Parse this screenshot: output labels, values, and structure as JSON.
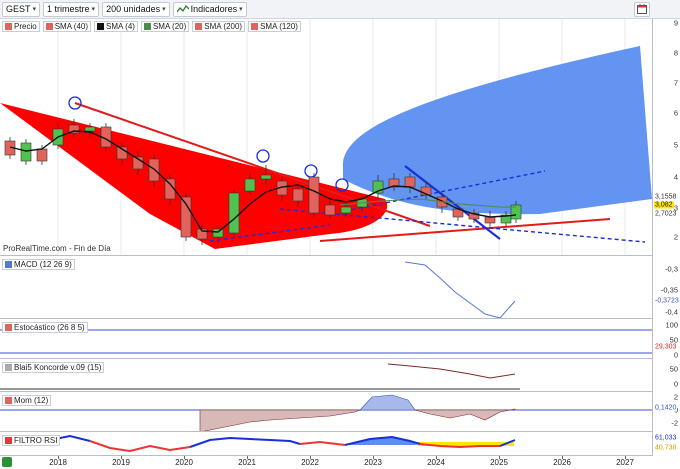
{
  "toolbar": {
    "symbol": "GEST",
    "period": "1 trimestre",
    "units": "200 unidades",
    "indicators_label": "Indicadores"
  },
  "legend": {
    "price": "Precio",
    "sma40": "SMA (40)",
    "sma4": "SMA (4)",
    "sma20": "SMA (20)",
    "sma200": "SMA (200)",
    "sma120": "SMA (120)"
  },
  "watermark": "ProRealTime.com - Fin de Día",
  "price_axis": {
    "ticks": [
      "9",
      "8",
      "7",
      "6",
      "5",
      "4",
      "3",
      "2"
    ],
    "labels": [
      "3,1558",
      "3,082",
      "2,7023"
    ]
  },
  "macd": {
    "label": "MACD (12 26 9)",
    "ticks": [
      "-0,3",
      "-0,35",
      "-0,4"
    ],
    "value": "-0,3723"
  },
  "stoch": {
    "label": "Estocástico (26 8 5)",
    "ticks": [
      "100",
      "50",
      "0"
    ],
    "value": "29,303"
  },
  "blai": {
    "label": "Blai5 Koncorde v.09 (15)",
    "ticks": [
      "50",
      "0"
    ]
  },
  "mom": {
    "label": "Mom (12)",
    "ticks": [
      "2",
      "0",
      "-2"
    ],
    "value": "0,1420"
  },
  "rsi": {
    "label": "FILTRO RSI",
    "ticks": [
      "61,033",
      "40,738"
    ]
  },
  "xaxis": {
    "years": [
      "2018",
      "2019",
      "2020",
      "2021",
      "2022",
      "2023",
      "2024",
      "2025",
      "2026",
      "2027"
    ]
  },
  "colors": {
    "up": "#4fc24f",
    "down": "#e0645c",
    "red_wedge": "#ff0000",
    "blue_fan": "#5b8ef0",
    "dark_blue": "#1a2fd6"
  }
}
